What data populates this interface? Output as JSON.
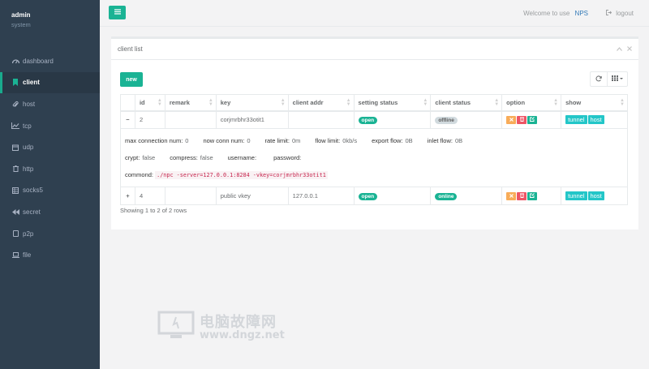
{
  "sidebar": {
    "user": "admin",
    "role": "system",
    "items": [
      {
        "label": "dashboard",
        "icon": "dashboard-icon"
      },
      {
        "label": "client",
        "icon": "bookmark-icon",
        "active": true
      },
      {
        "label": "host",
        "icon": "paperclip-icon"
      },
      {
        "label": "tcp",
        "icon": "line-chart-icon"
      },
      {
        "label": "udp",
        "icon": "calendar-icon"
      },
      {
        "label": "http",
        "icon": "trash-icon"
      },
      {
        "label": "socks5",
        "icon": "grid-icon"
      },
      {
        "label": "secret",
        "icon": "backward-icon"
      },
      {
        "label": "p2p",
        "icon": "copy-icon"
      },
      {
        "label": "file",
        "icon": "laptop-icon"
      }
    ]
  },
  "topbar": {
    "welcome": "Welcome to use",
    "brand": "NPS",
    "logout": "logout"
  },
  "panel": {
    "title": "client list",
    "new_label": "new",
    "columns": [
      "id",
      "remark",
      "key",
      "client addr",
      "setting status",
      "client status",
      "option",
      "show"
    ],
    "rows": [
      {
        "toggle": "−",
        "id": "2",
        "remark": "",
        "key": "corjmrbhr33otit1",
        "client_addr": "",
        "setting_status": "open",
        "client_status": "offline",
        "show": [
          "tunnel",
          "host"
        ],
        "detail": {
          "max_conn_label": "max connection num:",
          "max_conn": "0",
          "now_conn_label": "now conn num:",
          "now_conn": "0",
          "rate_label": "rate limit:",
          "rate": "0m",
          "flow_limit_label": "flow limit:",
          "flow_limit": "0kb/s",
          "export_flow_label": "export flow:",
          "export_flow": "0B",
          "inlet_flow_label": "inlet flow:",
          "inlet_flow": "0B",
          "crypt_label": "crypt:",
          "crypt": "false",
          "compress_label": "compress:",
          "compress": "false",
          "username_label": "username:",
          "username": "",
          "password_label": "password:",
          "password": "",
          "command_label": "commond:",
          "command": "./npc -server=127.0.0.1:8284 -vkey=corjmrbhr33otit1"
        }
      },
      {
        "toggle": "+",
        "id": "4",
        "remark": "",
        "key": "public vkey",
        "client_addr": "127.0.0.1",
        "setting_status": "open",
        "client_status": "online",
        "show": [
          "tunnel",
          "host"
        ]
      }
    ],
    "pager": "Showing 1 to 2 of 2 rows"
  },
  "watermark": {
    "cn": "电脑故障网",
    "url": "www.dngz.net"
  },
  "colors": {
    "sidebar_bg": "#2f4050",
    "accent_green": "#1ab394",
    "info_cyan": "#23c6c8",
    "warning": "#f8ac59",
    "danger": "#ed5565"
  }
}
